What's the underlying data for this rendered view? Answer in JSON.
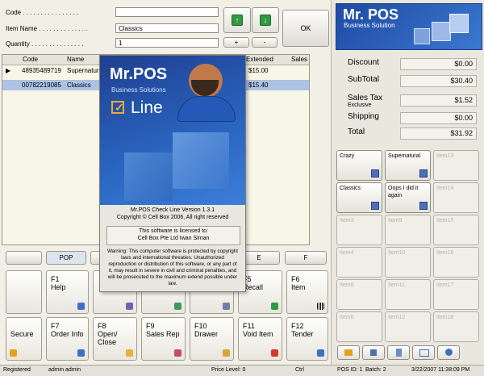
{
  "form": {
    "code_label": "Code . . . . . . . . . . . . . . . .",
    "code_value": "",
    "item_name_label": "Item Name . . . . . . . . . . . . . .",
    "item_name_value": "Classics",
    "quantity_label": "Quantity . . . . . . . . . . . . . . .",
    "quantity_value": "1",
    "plus_label": "+",
    "minus_label": "-",
    "ok_label": "OK",
    "up_glyph": "↑",
    "down_glyph": "↓"
  },
  "grid": {
    "headers": [
      "Code",
      "Name",
      "Extended",
      "Sales"
    ],
    "rows": [
      {
        "marker": "▶",
        "code": "48935489719",
        "name": "Supernatural",
        "extended": "$15.00"
      },
      {
        "marker": "",
        "code": "00782219085",
        "name": "Classics",
        "extended": "$15.40"
      }
    ]
  },
  "dept_buttons": [
    "",
    "POP",
    "",
    "",
    "",
    "E",
    "F"
  ],
  "fkeys_row1": [
    {
      "key": "",
      "text": ""
    },
    {
      "key": "F1",
      "text": "Help"
    },
    {
      "key": "",
      "text": ""
    },
    {
      "key": "",
      "text": ""
    },
    {
      "key": "",
      "text": ""
    },
    {
      "key": "F5",
      "text": "Recall"
    },
    {
      "key": "F6",
      "text": "Item"
    }
  ],
  "fkeys_row2": [
    {
      "key": "",
      "text": "Secure"
    },
    {
      "key": "F7",
      "text": "Order Info"
    },
    {
      "key": "F8",
      "text": "Open/ Close"
    },
    {
      "key": "F9",
      "text": "Sales Rep"
    },
    {
      "key": "F10",
      "text": "Drawer"
    },
    {
      "key": "F11",
      "text": "Void Item"
    },
    {
      "key": "F12",
      "text": "Tender"
    }
  ],
  "brand": {
    "title": "Mr. POS",
    "subtitle": "Business Solution"
  },
  "summary": {
    "discount_label": "Discount",
    "discount_value": "$0.00",
    "subtotal_label": "SubTotal",
    "subtotal_value": "$30.40",
    "salestax_label": "Sales Tax",
    "salestax_sub": "Exclusive",
    "salestax_value": "$1.52",
    "shipping_label": "Shipping",
    "shipping_value": "$0.00",
    "total_label": "Total",
    "total_value": "$31.92"
  },
  "items": [
    {
      "label": "Crazy",
      "active": true
    },
    {
      "label": "Supernatural",
      "active": true
    },
    {
      "label": "Item13",
      "active": false
    },
    {
      "label": "Classics",
      "active": true
    },
    {
      "label": "Oops I did it again",
      "active": true
    },
    {
      "label": "Item14",
      "active": false
    },
    {
      "label": "Item3",
      "active": false
    },
    {
      "label": "Item9",
      "active": false
    },
    {
      "label": "Item15",
      "active": false
    },
    {
      "label": "Item4",
      "active": false
    },
    {
      "label": "Item10",
      "active": false
    },
    {
      "label": "Item16",
      "active": false
    },
    {
      "label": "Item5",
      "active": false
    },
    {
      "label": "Item11",
      "active": false
    },
    {
      "label": "Item17",
      "active": false
    },
    {
      "label": "Item6",
      "active": false
    },
    {
      "label": "Item12",
      "active": false
    },
    {
      "label": "Item18",
      "active": false
    }
  ],
  "splash": {
    "logo": "Mr.POS",
    "tagline": "Business Solutions",
    "line": "Line",
    "version_line": "Mr.POS Check Line   Version 1.3.1",
    "copyright": "Copyright © Cell Box 2006, All right reserved",
    "license_1": "This software is licensed to:",
    "license_2": "Cell Box Pte Ltd Iwan Siman",
    "warning": "Warning: This computer software is protected by copyright laws and international threaties. Unauthorized reproduction or distribution of this software, or any part of it, may result in severe in civil and criminal penalties, and will be prosecuted to the maximum extend possible under law."
  },
  "status": {
    "registered": "Registered",
    "user": "admin admin",
    "price_level": "Price Level: 0",
    "ctrl": "Ctrl",
    "pos_id": "POS ID: 1",
    "batch": "Batch: 2",
    "datetime": "3/22/2007 11:38:09 PM"
  },
  "colors": {
    "brand_blue": "#2a66c2",
    "selected_row": "#aec2e3",
    "accent_green": "#2f9a3e"
  }
}
